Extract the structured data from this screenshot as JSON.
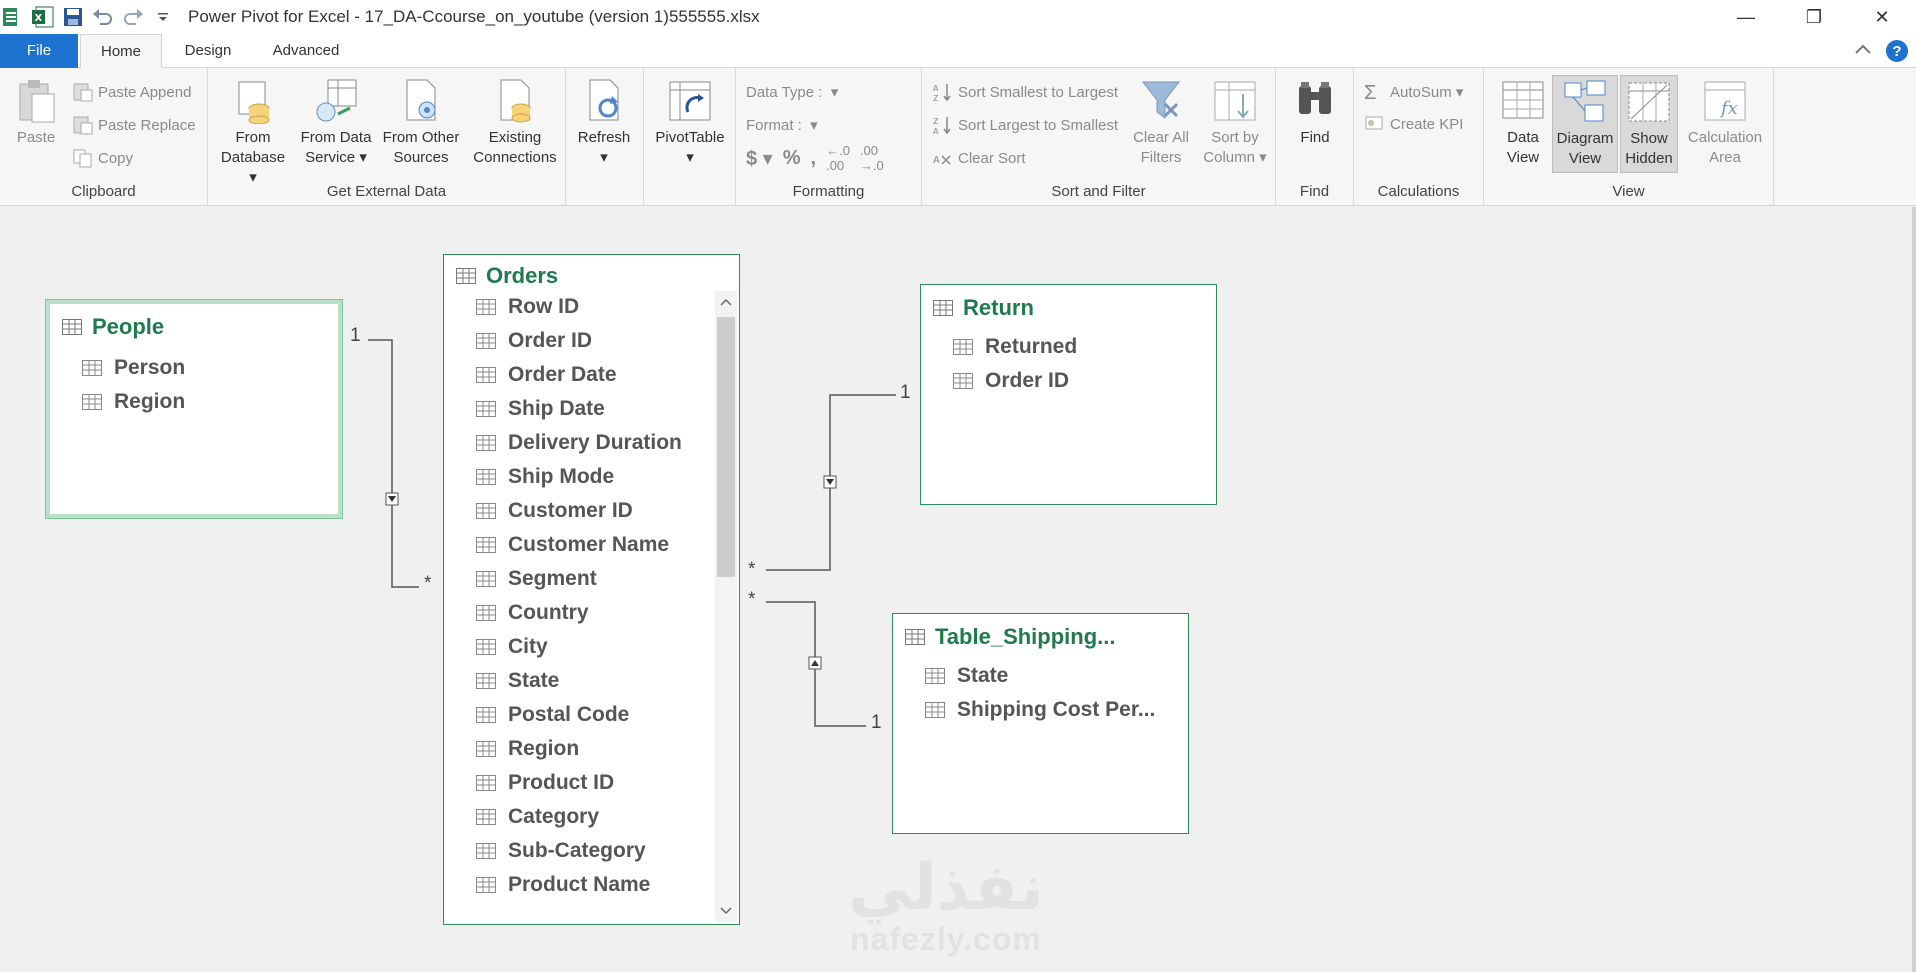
{
  "window": {
    "title": "Power Pivot for Excel - 17_DA-Ccourse_on_youtube (version 1)555555.xlsx",
    "controls": {
      "minimize": "—",
      "restore": "❐",
      "close": "✕"
    }
  },
  "tabs": {
    "file": "File",
    "home": "Home",
    "design": "Design",
    "advanced": "Advanced",
    "help": "?"
  },
  "ribbon": {
    "clipboard": {
      "label": "Clipboard",
      "paste": "Paste",
      "paste_append": "Paste Append",
      "paste_replace": "Paste Replace",
      "copy": "Copy"
    },
    "get_external_data": {
      "label": "Get External Data",
      "from_database": [
        "From",
        "Database"
      ],
      "from_data_service": [
        "From Data",
        "Service"
      ],
      "from_other_sources": [
        "From Other",
        "Sources"
      ],
      "existing_connections": [
        "Existing",
        "Connections"
      ]
    },
    "refresh": {
      "label": "Refresh"
    },
    "pivottable": {
      "label": "PivotTable"
    },
    "formatting": {
      "label": "Formatting",
      "data_type": "Data Type :",
      "format": "Format :"
    },
    "sort_filter": {
      "label": "Sort and Filter",
      "sort_smallest": "Sort Smallest to Largest",
      "sort_largest": "Sort Largest to Smallest",
      "clear_sort": "Clear Sort",
      "clear_all_filters": [
        "Clear All",
        "Filters"
      ],
      "sort_by_column": [
        "Sort by",
        "Column"
      ]
    },
    "find": {
      "label": "Find",
      "button": "Find"
    },
    "calculations": {
      "label": "Calculations",
      "autosum": "AutoSum",
      "create_kpi": "Create KPI"
    },
    "view": {
      "label": "View",
      "data_view": [
        "Data",
        "View"
      ],
      "diagram_view": [
        "Diagram",
        "View"
      ],
      "show_hidden": [
        "Show",
        "Hidden"
      ],
      "calculation_area": [
        "Calculation",
        "Area"
      ]
    }
  },
  "diagram": {
    "tables": {
      "people": {
        "title": "People",
        "columns": [
          "Person",
          "Region"
        ]
      },
      "orders": {
        "title": "Orders",
        "columns": [
          "Row ID",
          "Order ID",
          "Order Date",
          "Ship Date",
          "Delivery Duration",
          "Ship Mode",
          "Customer ID",
          "Customer Name",
          "Segment",
          "Country",
          "City",
          "State",
          "Postal Code",
          "Region",
          "Product ID",
          "Category",
          "Sub-Category",
          "Product Name"
        ]
      },
      "return": {
        "title": "Return",
        "columns": [
          "Returned",
          "Order ID"
        ]
      },
      "shipping": {
        "title": "Table_Shipping...",
        "columns": [
          "State",
          "Shipping Cost Per..."
        ]
      }
    },
    "relationships": {
      "one": "1",
      "many": "*"
    }
  },
  "watermark": {
    "arabic": "نفذلي",
    "latin": "nafezly.com"
  },
  "colors": {
    "accent": "#1e73d0",
    "table_border": "#2e8b57",
    "table_title": "#1f7a4d"
  }
}
